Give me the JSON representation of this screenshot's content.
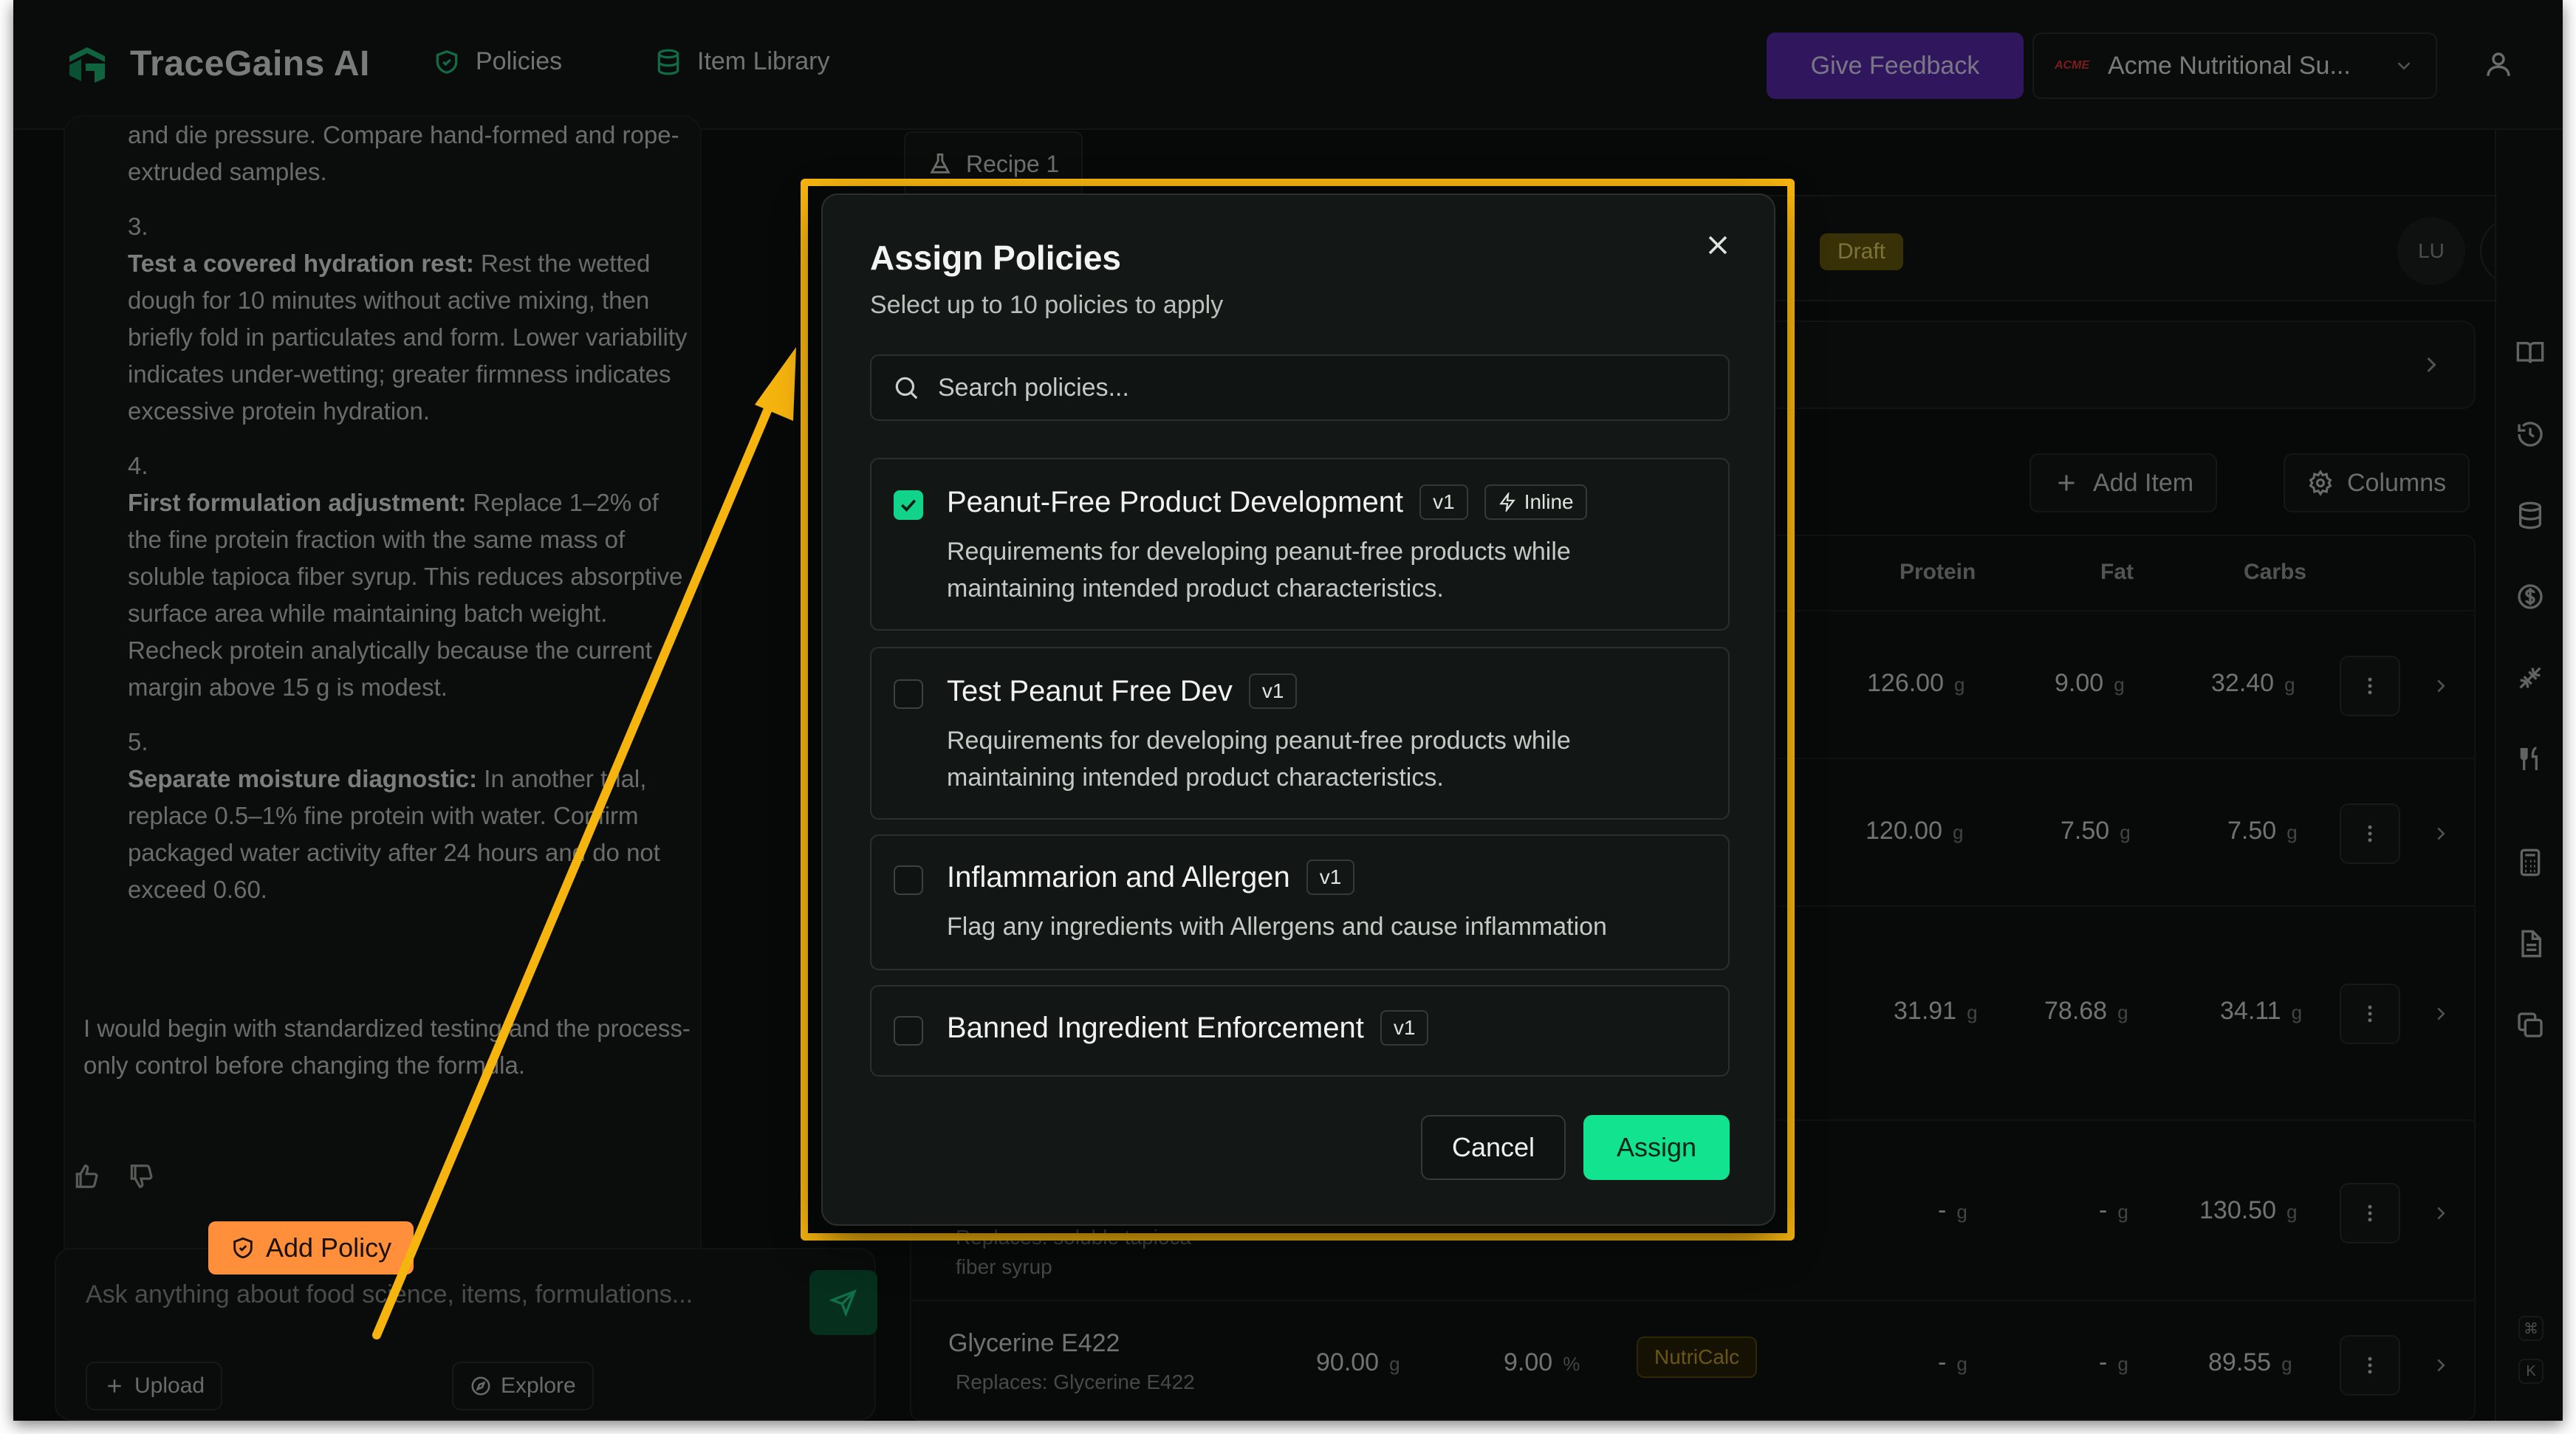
{
  "app": {
    "brand": "TraceGains AI",
    "nav": [
      {
        "label": "Policies",
        "icon": "shield-check-icon"
      },
      {
        "label": "Item Library",
        "icon": "database-icon"
      }
    ],
    "feedback_label": "Give Feedback",
    "org_name": "Acme Nutritional Su...",
    "org_logo_text": "ACME"
  },
  "chat": {
    "intro_text": "and die pressure. Compare hand-formed and rope-extruded samples.",
    "steps": [
      {
        "num": "3.",
        "bold": "Test a covered hydration rest:",
        "text": " Rest the wetted dough for 10 minutes without active mixing, then briefly fold in particulates and form. Lower variability indicates under-wetting; greater firmness indicates excessive protein hydration."
      },
      {
        "num": "4.",
        "bold": "First formulation adjustment:",
        "text": " Replace 1–2% of the fine protein fraction with the same mass of soluble tapioca fiber syrup. This reduces absorptive surface area while maintaining batch weight. Recheck protein analytically because the current margin above 15 g is modest."
      },
      {
        "num": "5.",
        "bold": "Separate moisture diagnostic:",
        "text": " In another trial, replace 0.5–1% fine protein with water. Confirm packaged water activity after 24 hours and do not exceed 0.60."
      }
    ],
    "closing": "I would begin with standardized testing and the process-only control before changing the formula.",
    "composer_placeholder": "Ask anything about food science, items, formulations...",
    "upload_label": "Upload",
    "add_policy_label": "Add Policy",
    "explore_label": "Explore"
  },
  "recipe": {
    "tab_label": "Recipe 1",
    "status_badge": "Draft",
    "avatar_initials": "LU",
    "add_item_label": "Add Item",
    "columns_label": "Columns",
    "columns": [
      "Protein",
      "Fat",
      "Carbs"
    ],
    "rows": [
      {
        "protein": "126.00",
        "fat": "9.00",
        "carbs": "32.40"
      },
      {
        "protein": "120.00",
        "fat": "7.50",
        "carbs": "7.50"
      },
      {
        "protein": "31.91",
        "fat": "78.68",
        "carbs": "34.11"
      },
      {
        "protein": "-",
        "fat": "-",
        "carbs": "130.50",
        "sub_text": "Replaces: soluble tapioca",
        "sub_text2": "fiber syrup"
      },
      {
        "name": "Glycerine E422",
        "sub_text": "Replaces: Glycerine E422",
        "amount": "90.00",
        "percent": "9.00",
        "source": "NutriCalc",
        "protein": "-",
        "fat": "-",
        "carbs": "89.55"
      }
    ],
    "unit_g": "g",
    "unit_pct": "%"
  },
  "modal": {
    "title": "Assign Policies",
    "subtitle": "Select up to 10 policies to apply",
    "search_placeholder": "Search policies...",
    "policies": [
      {
        "name": "Peanut-Free Product Development",
        "version": "v1",
        "tag": "Inline",
        "checked": true,
        "description": "Requirements for developing peanut-free products while maintaining intended product characteristics."
      },
      {
        "name": "Test Peanut Free Dev",
        "version": "v1",
        "checked": false,
        "description": "Requirements for developing peanut-free products while maintaining intended product characteristics."
      },
      {
        "name": "Inflammarion and Allergen",
        "version": "v1",
        "checked": false,
        "description": "Flag any ingredients with Allergens and cause inflammation"
      },
      {
        "name": "Banned Ingredient Enforcement",
        "version": "v1",
        "checked": false
      }
    ],
    "cancel_label": "Cancel",
    "assign_label": "Assign"
  },
  "shortcut_keys": [
    "⌘",
    "K"
  ],
  "colors": {
    "accent_green": "#12e38f",
    "feedback_purple": "#5b2bb3",
    "highlight_yellow": "#f6b40e",
    "add_policy_orange": "#ff8f3a"
  }
}
